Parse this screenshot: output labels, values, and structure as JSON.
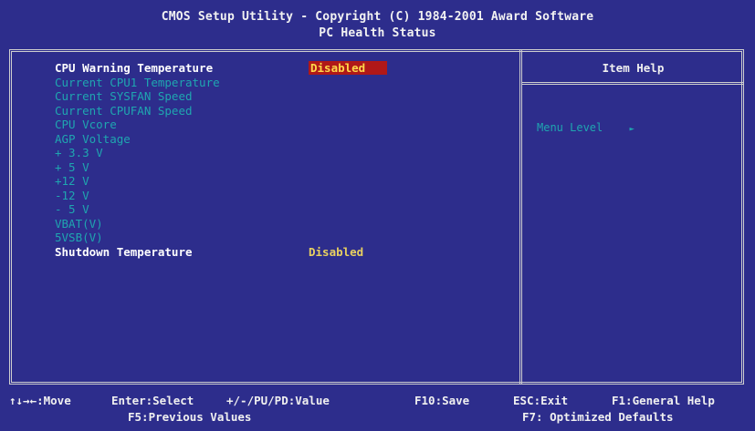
{
  "header": {
    "title_line1": "CMOS Setup Utility - Copyright (C) 1984-2001 Award Software",
    "title_line2": "PC Health Status"
  },
  "settings": [
    {
      "label": "CPU Warning Temperature",
      "value": "Disabled",
      "style": "active",
      "selected": true
    },
    {
      "label": "Current CPU1 Temperature",
      "value": "",
      "style": "dim"
    },
    {
      "label": "Current SYSFAN Speed",
      "value": "",
      "style": "dim"
    },
    {
      "label": "Current CPUFAN Speed",
      "value": "",
      "style": "dim"
    },
    {
      "label": "CPU Vcore",
      "value": "",
      "style": "dim"
    },
    {
      "label": "AGP Voltage",
      "value": "",
      "style": "dim"
    },
    {
      "label": "+ 3.3 V",
      "value": "",
      "style": "dim"
    },
    {
      "label": "+ 5 V",
      "value": "",
      "style": "dim"
    },
    {
      "label": "+12 V",
      "value": "",
      "style": "dim"
    },
    {
      "label": "-12 V",
      "value": "",
      "style": "dim"
    },
    {
      "label": "- 5 V",
      "value": "",
      "style": "dim"
    },
    {
      "label": "VBAT(V)",
      "value": "",
      "style": "dim"
    },
    {
      "label": "5VSB(V)",
      "value": "",
      "style": "dim"
    },
    {
      "label": "Shutdown Temperature",
      "value": "Disabled",
      "style": "active",
      "selected": false
    }
  ],
  "help_panel": {
    "title": "Item Help",
    "menu_level_label": "Menu Level",
    "menu_level_arrow": "►"
  },
  "footer": {
    "move": "↑↓→←:Move",
    "enter": "Enter:Select",
    "value": "+/-/PU/PD:Value",
    "save": "F10:Save",
    "exit": "ESC:Exit",
    "help": "F1:General Help",
    "prev": "F5:Previous Values",
    "defaults": "F7: Optimized Defaults"
  },
  "colors": {
    "background": "#2d2d8c",
    "dim_text": "#1fa6b0",
    "value_text": "#e8d060",
    "selection_bg": "#b01818"
  }
}
